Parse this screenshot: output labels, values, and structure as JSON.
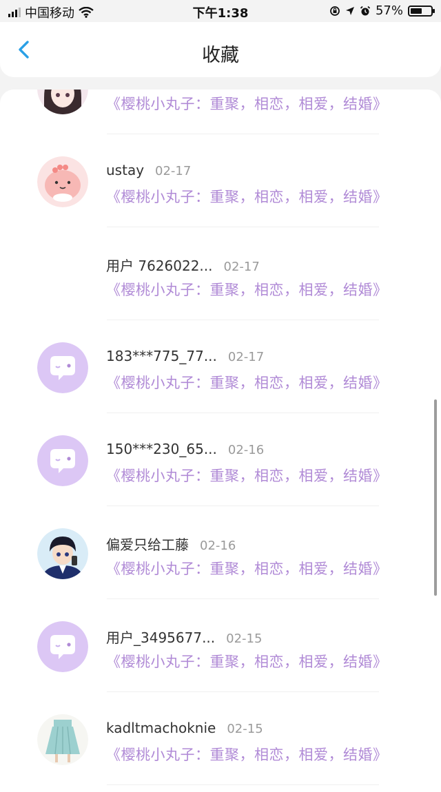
{
  "status_bar": {
    "carrier": "中国移动",
    "time": "下午1:38",
    "battery_pct": "57%",
    "battery_level": 0.57,
    "icons": [
      "signal-icon",
      "wifi-icon",
      "rotation-lock-icon",
      "location-arrow-icon",
      "alarm-icon",
      "battery-icon"
    ]
  },
  "header": {
    "title": "收藏",
    "back_icon": "chevron-left-icon"
  },
  "accent_color": "#b08ad6",
  "items": [
    {
      "name": "",
      "date": "",
      "text": "《樱桃小丸子：重聚，相恋，相爱，结婚》",
      "avatar": "anime-girl"
    },
    {
      "name": "ustay",
      "date": "02-17",
      "text": "《樱桃小丸子：重聚，相恋，相爱，结婚》",
      "avatar": "pink-blob"
    },
    {
      "name": "用户 7626022...",
      "date": "02-17",
      "text": "《樱桃小丸子：重聚，相恋，相爱，结婚》",
      "avatar": "none"
    },
    {
      "name": "183***775_77...",
      "date": "02-17",
      "text": "《樱桃小丸子：重聚，相恋，相爱，结婚》",
      "avatar": "default-chat"
    },
    {
      "name": "150***230_65...",
      "date": "02-16",
      "text": "《樱桃小丸子：重聚，相恋，相爱，结婚》",
      "avatar": "default-chat"
    },
    {
      "name": "偏爱只给工藤",
      "date": "02-16",
      "text": "《樱桃小丸子：重聚，相恋，相爱，结婚》",
      "avatar": "anime-boy"
    },
    {
      "name": "用户_3495677...",
      "date": "02-15",
      "text": "《樱桃小丸子：重聚，相恋，相爱，结婚》",
      "avatar": "default-chat"
    },
    {
      "name": "kadltmachoknie",
      "date": "02-15",
      "text": "《樱桃小丸子：重聚，相恋，相爱，结婚》",
      "avatar": "skirt"
    }
  ]
}
